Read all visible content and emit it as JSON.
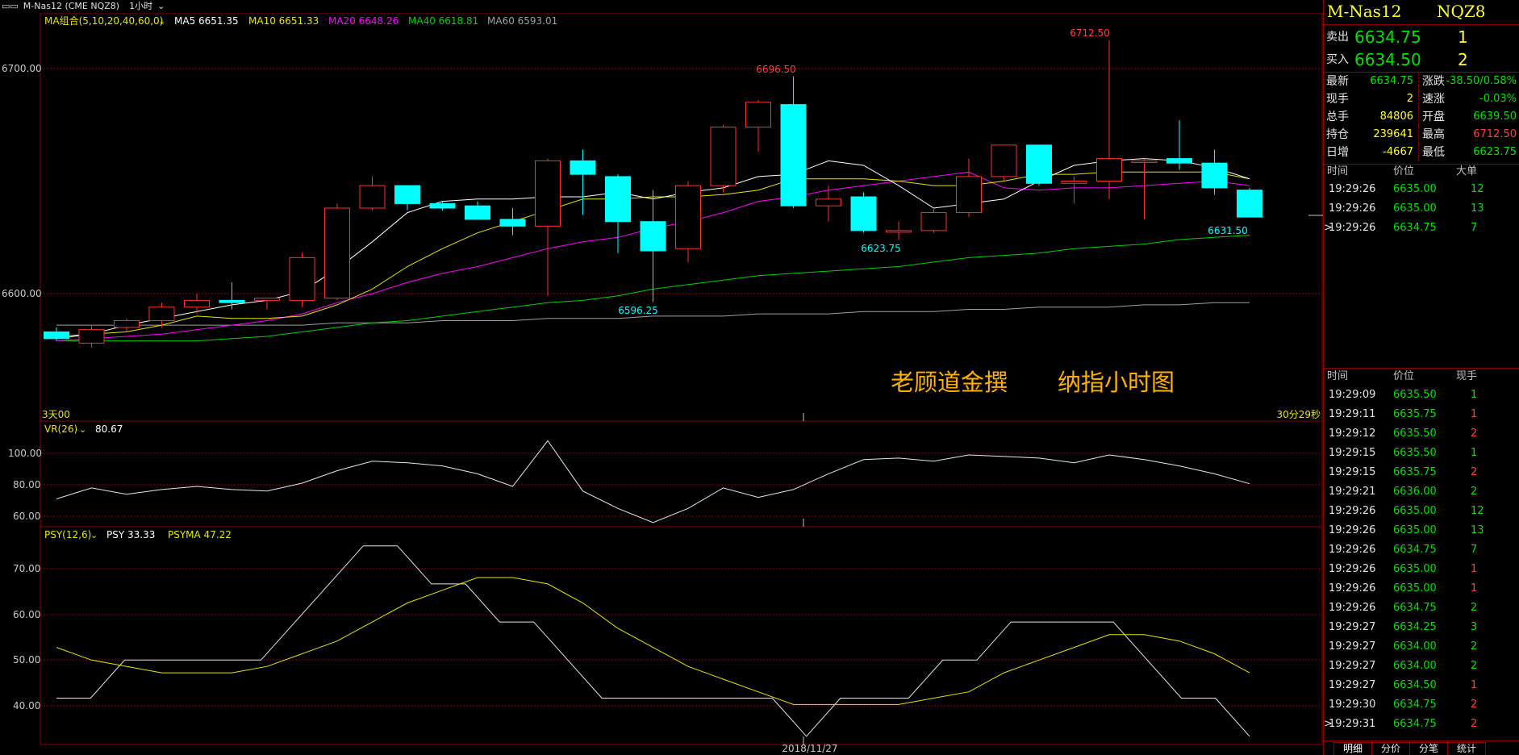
{
  "titlebar": {
    "icon": "window-icon",
    "symbol": "M-Nas12 (CME NQZ8)",
    "period": "1小时"
  },
  "main_legend": {
    "group": "MA组合(5,10,20,40,60,0)",
    "ma5": "MA5 6651.35",
    "ma10": "MA10 6651.33",
    "ma20": "MA20 6648.26",
    "ma40": "MA40 6618.81",
    "ma60": "MA60 6593.01"
  },
  "colors": {
    "ma5": "#ffffff",
    "ma10": "#e6e600",
    "ma20": "#ff00ff",
    "ma40": "#00d000",
    "ma60": "#a0a0a0",
    "up": "#ff3030",
    "down": "#00ffff",
    "grid": "#8b0000",
    "axis": "#c8c8c8"
  },
  "axis_labels": {
    "p6700": "6700.00",
    "p6600": "6600.00",
    "v100": "100.00",
    "v80": "80.00",
    "v60": "60.00",
    "s70": "70.00",
    "s60": "60.00",
    "s50": "50.00",
    "s40": "40.00"
  },
  "chart_annotations": {
    "hi1": "6696.50",
    "hi2": "6712.50",
    "lo1": "6596.25",
    "lo2": "6623.75",
    "lo3": "6631.50",
    "days": "3天00",
    "countdown": "30分29秒",
    "date": "2018/11/27"
  },
  "watermark": {
    "author": "老顾道金撰",
    "title": "纳指小时图"
  },
  "vr_legend": {
    "name": "VR(26)",
    "value": "80.67"
  },
  "psy_legend": {
    "name": "PSY(12,6)",
    "psy": "PSY 33.33",
    "psyma": "PSYMA 47.22"
  },
  "chart_data": [
    {
      "type": "candlestick",
      "title": "",
      "ylim": [
        6545,
        6730
      ],
      "candles": [
        {
          "o": 6583,
          "h": 6585,
          "l": 6579,
          "c": 6580
        },
        {
          "o": 6578,
          "h": 6586,
          "l": 6576,
          "c": 6584
        },
        {
          "o": 6585,
          "h": 6589,
          "l": 6583,
          "c": 6588
        },
        {
          "o": 6588,
          "h": 6596,
          "l": 6585,
          "c": 6594
        },
        {
          "o": 6594,
          "h": 6600,
          "l": 6591,
          "c": 6597
        },
        {
          "o": 6597,
          "h": 6605,
          "l": 6593,
          "c": 6596
        },
        {
          "o": 6597,
          "h": 6598,
          "l": 6593,
          "c": 6598
        },
        {
          "o": 6597,
          "h": 6618,
          "l": 6594,
          "c": 6616
        },
        {
          "o": 6598,
          "h": 6640,
          "l": 6597,
          "c": 6638
        },
        {
          "o": 6638,
          "h": 6652,
          "l": 6637,
          "c": 6648
        },
        {
          "o": 6648,
          "h": 6648,
          "l": 6637,
          "c": 6640
        },
        {
          "o": 6640,
          "h": 6641,
          "l": 6637,
          "c": 6638
        },
        {
          "o": 6639,
          "h": 6641,
          "l": 6633,
          "c": 6633
        },
        {
          "o": 6633,
          "h": 6638,
          "l": 6626,
          "c": 6630
        },
        {
          "o": 6630,
          "h": 6660,
          "l": 6599,
          "c": 6659
        },
        {
          "o": 6659,
          "h": 6664,
          "l": 6635,
          "c": 6653
        },
        {
          "o": 6652,
          "h": 6653,
          "l": 6618,
          "c": 6632
        },
        {
          "o": 6632,
          "h": 6646,
          "l": 6596.25,
          "c": 6619
        },
        {
          "o": 6620,
          "h": 6650,
          "l": 6614,
          "c": 6648
        },
        {
          "o": 6648,
          "h": 6675,
          "l": 6645,
          "c": 6674
        },
        {
          "o": 6674,
          "h": 6686,
          "l": 6663,
          "c": 6685
        },
        {
          "o": 6684,
          "h": 6696.5,
          "l": 6638,
          "c": 6639
        },
        {
          "o": 6639,
          "h": 6648,
          "l": 6632,
          "c": 6642
        },
        {
          "o": 6643,
          "h": 6645,
          "l": 6627,
          "c": 6628
        },
        {
          "o": 6628,
          "h": 6632,
          "l": 6623.75,
          "c": 6628
        },
        {
          "o": 6628,
          "h": 6638,
          "l": 6627,
          "c": 6636
        },
        {
          "o": 6636,
          "h": 6660,
          "l": 6634,
          "c": 6652
        },
        {
          "o": 6652,
          "h": 6666,
          "l": 6650,
          "c": 6666
        },
        {
          "o": 6666,
          "h": 6666,
          "l": 6648,
          "c": 6649
        },
        {
          "o": 6649,
          "h": 6652,
          "l": 6640,
          "c": 6650
        },
        {
          "o": 6650,
          "h": 6712.5,
          "l": 6642,
          "c": 6660
        },
        {
          "o": 6659,
          "h": 6660,
          "l": 6633,
          "c": 6659
        },
        {
          "o": 6660,
          "h": 6677,
          "l": 6655,
          "c": 6658
        },
        {
          "o": 6658,
          "h": 6664,
          "l": 6644,
          "c": 6647
        },
        {
          "o": 6646,
          "h": 6647,
          "l": 6634,
          "c": 6634
        }
      ],
      "ma5": [
        6580,
        6582,
        6586,
        6589,
        6592,
        6595,
        6597,
        6601,
        6611,
        6623,
        6636,
        6641,
        6642,
        6642,
        6643,
        6643,
        6645,
        6642,
        6645,
        6647,
        6652,
        6653,
        6659,
        6657,
        6648,
        6638,
        6640,
        6642,
        6650,
        6657,
        6659,
        6660,
        6659,
        6656,
        6651
      ],
      "ma10": [
        6581,
        6582,
        6583,
        6586,
        6590,
        6589,
        6589,
        6590,
        6595,
        6602,
        6612,
        6620,
        6627,
        6632,
        6637,
        6642,
        6642,
        6643,
        6643,
        6644,
        6646,
        6651,
        6651,
        6651,
        6650,
        6648,
        6648,
        6650,
        6653,
        6653,
        6654,
        6654,
        6654,
        6654,
        6651
      ],
      "ma20": [
        6579,
        6580,
        6581,
        6582,
        6584,
        6586,
        6588,
        6591,
        6596,
        6600,
        6605,
        6609,
        6612,
        6616,
        6620,
        6623,
        6625,
        6629,
        6632,
        6636,
        6641,
        6643,
        6646,
        6648,
        6650,
        6652,
        6654,
        6647,
        6646,
        6647,
        6647,
        6648,
        6649,
        6650,
        6648
      ],
      "ma40": [
        6579,
        6579,
        6579,
        6579,
        6579,
        6580,
        6581,
        6583,
        6585,
        6587,
        6588,
        6590,
        6592,
        6594,
        6596,
        6597,
        6599,
        6602,
        6604,
        6606,
        6608,
        6609,
        6610,
        6611,
        6612,
        6614,
        6616,
        6617,
        6618,
        6620,
        6621,
        6622,
        6624,
        6625,
        6626
      ],
      "ma60": [
        6586,
        6586,
        6586,
        6586,
        6586,
        6586,
        6586,
        6586,
        6587,
        6587,
        6587,
        6588,
        6588,
        6588,
        6589,
        6589,
        6589,
        6590,
        6590,
        6590,
        6591,
        6591,
        6591,
        6592,
        6592,
        6592,
        6593,
        6593,
        6594,
        6594,
        6594,
        6595,
        6595,
        6596,
        6596
      ]
    },
    {
      "type": "line",
      "title": "VR(26)",
      "ylim": [
        50,
        118
      ],
      "series": [
        {
          "name": "VR",
          "values": [
            71,
            78,
            74,
            77,
            79,
            77,
            76,
            81,
            89,
            95,
            94,
            92,
            87,
            79,
            108,
            76,
            65,
            56,
            65,
            78,
            72,
            77,
            87,
            96,
            97,
            95,
            99,
            98,
            97,
            94,
            99,
            96,
            92,
            87,
            80.67
          ]
        }
      ]
    },
    {
      "type": "line",
      "title": "PSY(12,6)",
      "ylim": [
        32,
        78
      ],
      "series": [
        {
          "name": "PSY",
          "values": [
            41.67,
            41.67,
            50,
            50,
            50,
            50,
            50,
            58.33,
            66.67,
            75,
            75,
            66.67,
            66.67,
            58.33,
            58.33,
            50,
            41.67,
            41.67,
            41.67,
            41.67,
            41.67,
            41.67,
            33.33,
            41.67,
            41.67,
            41.67,
            50,
            50,
            58.33,
            58.33,
            58.33,
            58.33,
            50,
            41.67,
            41.67,
            33.33
          ]
        },
        {
          "name": "PSYMA",
          "values": [
            52.78,
            50,
            48.61,
            47.22,
            47.22,
            47.22,
            48.61,
            51.39,
            54.17,
            58.33,
            62.5,
            65.28,
            68.06,
            68.06,
            66.67,
            62.5,
            56.94,
            52.78,
            48.61,
            45.83,
            43.06,
            40.28,
            40.28,
            40.28,
            40.28,
            41.67,
            43.06,
            47.22,
            50,
            52.78,
            55.56,
            55.56,
            54.17,
            51.39,
            47.22
          ]
        }
      ]
    }
  ],
  "right_panel": {
    "symbol": "M-Nas12",
    "code": "NQZ8",
    "ask_label": "卖出",
    "ask_price": "6634.75",
    "ask_qty": "1",
    "bid_label": "买入",
    "bid_price": "6634.50",
    "bid_qty": "2",
    "stats": [
      {
        "l1": "最新",
        "v1": "6634.75",
        "c1": "green",
        "l2": "涨跌",
        "v2": "-38.50/0.58%",
        "c2": "green"
      },
      {
        "l1": "现手",
        "v1": "2",
        "c1": "yellow",
        "l2": "速涨",
        "v2": "-0.03%",
        "c2": "green"
      },
      {
        "l1": "总手",
        "v1": "84806",
        "c1": "yellow",
        "l2": "开盘",
        "v2": "6639.50",
        "c2": "green"
      },
      {
        "l1": "持仓",
        "v1": "239641",
        "c1": "yellow",
        "l2": "最高",
        "v2": "6712.50",
        "c2": "red"
      },
      {
        "l1": "日增",
        "v1": "-4667",
        "c1": "yellow",
        "l2": "最低",
        "v2": "6623.75",
        "c2": "green"
      }
    ],
    "big_header": {
      "time": "时间",
      "price": "价位",
      "size": "大单"
    },
    "big_orders": [
      {
        "time": "19:29:26",
        "price": "6635.00",
        "qty": "12",
        "qc": "green",
        "mark": ""
      },
      {
        "time": "19:29:26",
        "price": "6635.00",
        "qty": "13",
        "qc": "green",
        "mark": ""
      },
      {
        "time": "19:29:26",
        "price": "6634.75",
        "qty": "7",
        "qc": "green",
        "mark": ">"
      }
    ],
    "tick_header": {
      "time": "时间",
      "price": "价位",
      "size": "现手"
    },
    "ticks": [
      {
        "time": "19:29:09",
        "price": "6635.50",
        "qty": "1",
        "qc": "green",
        "mark": ""
      },
      {
        "time": "19:29:11",
        "price": "6635.75",
        "qty": "1",
        "qc": "red",
        "mark": ""
      },
      {
        "time": "19:29:12",
        "price": "6635.50",
        "qty": "2",
        "qc": "red",
        "mark": ""
      },
      {
        "time": "19:29:15",
        "price": "6635.50",
        "qty": "1",
        "qc": "green",
        "mark": ""
      },
      {
        "time": "19:29:15",
        "price": "6635.75",
        "qty": "2",
        "qc": "red",
        "mark": ""
      },
      {
        "time": "19:29:21",
        "price": "6636.00",
        "qty": "2",
        "qc": "green",
        "mark": ""
      },
      {
        "time": "19:29:26",
        "price": "6635.00",
        "qty": "12",
        "qc": "green",
        "mark": ""
      },
      {
        "time": "19:29:26",
        "price": "6635.00",
        "qty": "13",
        "qc": "green",
        "mark": ""
      },
      {
        "time": "19:29:26",
        "price": "6634.75",
        "qty": "7",
        "qc": "green",
        "mark": ""
      },
      {
        "time": "19:29:26",
        "price": "6635.00",
        "qty": "1",
        "qc": "red",
        "mark": ""
      },
      {
        "time": "19:29:26",
        "price": "6635.00",
        "qty": "1",
        "qc": "red",
        "mark": ""
      },
      {
        "time": "19:29:26",
        "price": "6634.75",
        "qty": "2",
        "qc": "green",
        "mark": ""
      },
      {
        "time": "19:29:27",
        "price": "6634.25",
        "qty": "3",
        "qc": "green",
        "mark": ""
      },
      {
        "time": "19:29:27",
        "price": "6634.00",
        "qty": "2",
        "qc": "green",
        "mark": ""
      },
      {
        "time": "19:29:27",
        "price": "6634.00",
        "qty": "2",
        "qc": "green",
        "mark": ""
      },
      {
        "time": "19:29:27",
        "price": "6634.50",
        "qty": "1",
        "qc": "red",
        "mark": ""
      },
      {
        "time": "19:29:30",
        "price": "6634.75",
        "qty": "2",
        "qc": "red",
        "mark": ""
      },
      {
        "time": "19:29:31",
        "price": "6634.75",
        "qty": "2",
        "qc": "red",
        "mark": ">"
      }
    ],
    "tabs": [
      "明细",
      "分价",
      "分笔",
      "统计"
    ]
  }
}
